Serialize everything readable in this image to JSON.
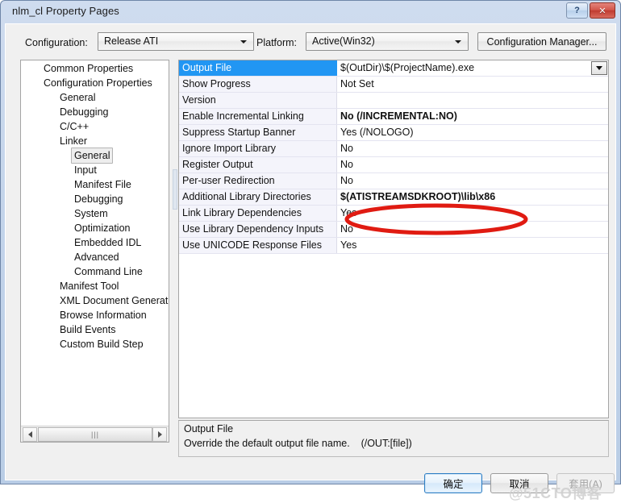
{
  "window": {
    "title": "nlm_cl Property Pages",
    "help_button": "?",
    "close_button": "✕"
  },
  "config_bar": {
    "configuration_label": "Configuration:",
    "configuration_value": "Release ATI",
    "platform_label": "Platform:",
    "platform_value": "Active(Win32)",
    "configuration_manager_button": "Configuration Manager..."
  },
  "tree": {
    "items": [
      {
        "label": "Common Properties",
        "depth": 0,
        "selected": false
      },
      {
        "label": "Configuration Properties",
        "depth": 0,
        "selected": false
      },
      {
        "label": "General",
        "depth": 1,
        "selected": false
      },
      {
        "label": "Debugging",
        "depth": 1,
        "selected": false
      },
      {
        "label": "C/C++",
        "depth": 1,
        "selected": false
      },
      {
        "label": "Linker",
        "depth": 1,
        "selected": false
      },
      {
        "label": "General",
        "depth": 2,
        "selected": true
      },
      {
        "label": "Input",
        "depth": 2,
        "selected": false
      },
      {
        "label": "Manifest File",
        "depth": 2,
        "selected": false
      },
      {
        "label": "Debugging",
        "depth": 2,
        "selected": false
      },
      {
        "label": "System",
        "depth": 2,
        "selected": false
      },
      {
        "label": "Optimization",
        "depth": 2,
        "selected": false
      },
      {
        "label": "Embedded IDL",
        "depth": 2,
        "selected": false
      },
      {
        "label": "Advanced",
        "depth": 2,
        "selected": false
      },
      {
        "label": "Command Line",
        "depth": 2,
        "selected": false
      },
      {
        "label": "Manifest Tool",
        "depth": 1,
        "selected": false
      },
      {
        "label": "XML Document Generator",
        "depth": 1,
        "selected": false
      },
      {
        "label": "Browse Information",
        "depth": 1,
        "selected": false
      },
      {
        "label": "Build Events",
        "depth": 1,
        "selected": false
      },
      {
        "label": "Custom Build Step",
        "depth": 1,
        "selected": false
      }
    ],
    "scrollbar_grip": "|||"
  },
  "grid": {
    "rows": [
      {
        "name": "Output File",
        "value": "$(OutDir)\\$(ProjectName).exe",
        "selected": true,
        "bold": false,
        "dropdown": true
      },
      {
        "name": "Show Progress",
        "value": "Not Set",
        "selected": false,
        "bold": false,
        "dropdown": false
      },
      {
        "name": "Version",
        "value": "",
        "selected": false,
        "bold": false,
        "dropdown": false
      },
      {
        "name": "Enable Incremental Linking",
        "value": "No (/INCREMENTAL:NO)",
        "selected": false,
        "bold": true,
        "dropdown": false
      },
      {
        "name": "Suppress Startup Banner",
        "value": "Yes (/NOLOGO)",
        "selected": false,
        "bold": false,
        "dropdown": false
      },
      {
        "name": "Ignore Import Library",
        "value": "No",
        "selected": false,
        "bold": false,
        "dropdown": false
      },
      {
        "name": "Register Output",
        "value": "No",
        "selected": false,
        "bold": false,
        "dropdown": false
      },
      {
        "name": "Per-user Redirection",
        "value": "No",
        "selected": false,
        "bold": false,
        "dropdown": false
      },
      {
        "name": "Additional Library Directories",
        "value": "$(ATISTREAMSDKROOT)\\lib\\x86",
        "selected": false,
        "bold": true,
        "dropdown": false
      },
      {
        "name": "Link Library Dependencies",
        "value": "Yes",
        "selected": false,
        "bold": false,
        "dropdown": false
      },
      {
        "name": "Use Library Dependency Inputs",
        "value": "No",
        "selected": false,
        "bold": false,
        "dropdown": false
      },
      {
        "name": "Use UNICODE Response Files",
        "value": "Yes",
        "selected": false,
        "bold": false,
        "dropdown": false
      }
    ]
  },
  "annotation": {
    "shape": "ellipse",
    "color": "#e01b12",
    "target_row": "Additional Library Directories"
  },
  "description": {
    "title": "Output File",
    "text": "Override the default output file name.    (/OUT:[file])"
  },
  "footer": {
    "ok_label": "确定",
    "cancel_label": "取消",
    "apply_label": "套用(A)"
  },
  "watermark": {
    "text": "@51CTO博客"
  },
  "colors": {
    "selection_blue": "#2196f3",
    "annotation_red": "#e01b12",
    "dialog_face": "#f0f0f0",
    "title_gradient_top": "#cfdcef",
    "title_gradient_bottom": "#b9cde6"
  }
}
